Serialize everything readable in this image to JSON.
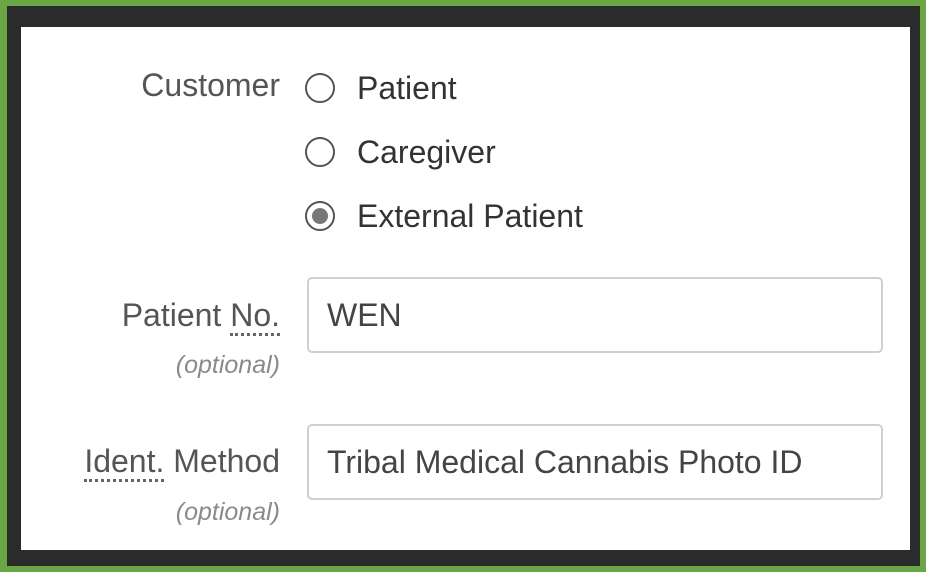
{
  "form": {
    "customer": {
      "label": "Customer",
      "options": [
        {
          "label": "Patient",
          "checked": false
        },
        {
          "label": "Caregiver",
          "checked": false
        },
        {
          "label": "External Patient",
          "checked": true
        }
      ]
    },
    "patient_no": {
      "label_prefix": "Patient ",
      "label_abbr": "No.",
      "optional": "(optional)",
      "value": "WEN"
    },
    "ident_method": {
      "label_abbr": "Ident.",
      "label_suffix": " Method",
      "optional": "(optional)",
      "value": "Tribal Medical Cannabis Photo ID"
    }
  },
  "colors": {
    "outer_border": "#6aa744",
    "inner_border": "#2b2b2b",
    "panel_bg": "#ffffff"
  }
}
